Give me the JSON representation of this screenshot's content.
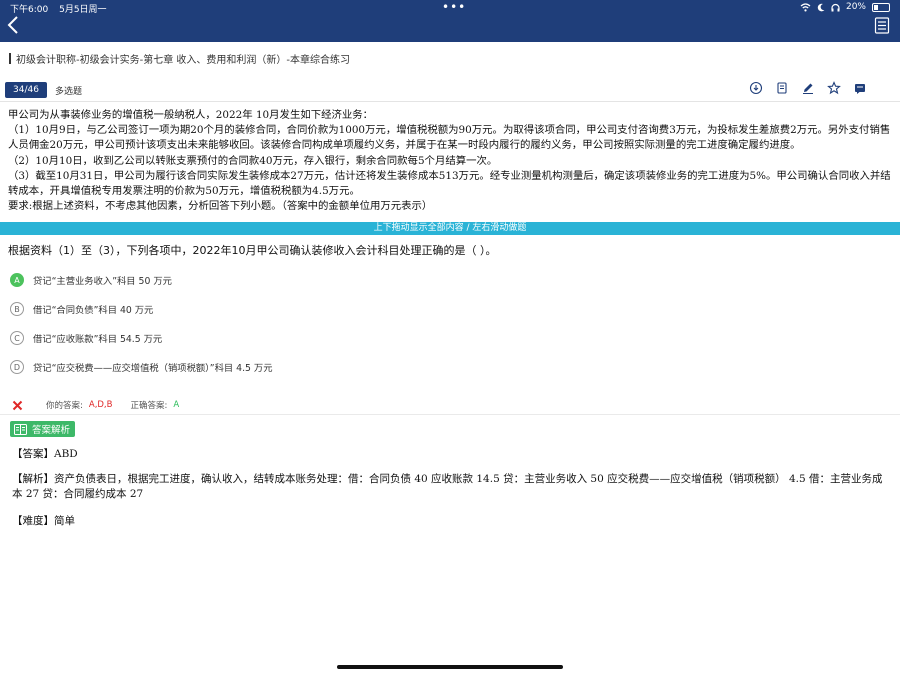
{
  "status": {
    "time": "下午6:00",
    "date": "5月5日周一",
    "dots": "•••",
    "battery": "20%"
  },
  "topbar": {
    "back_icon": "chevron-left-icon",
    "menu_icon": "answer-sheet-icon"
  },
  "breadcrumb": "初级会计职称-初级会计实务-第七章 收入、费用和利润（新）-本章综合练习",
  "question_header": {
    "number": "34/46",
    "type": "多选题",
    "tools": [
      "download-icon",
      "copy-icon",
      "edit-icon",
      "star-icon",
      "note-icon"
    ]
  },
  "stem": [
    "甲公司为从事装修业务的增值税一般纳税人，2022年 10月发生如下经济业务：",
    "（1）10月9日，与乙公司签订一项为期20个月的装修合同，合同价款为1000万元，增值税税额为90万元。为取得该项合同，甲公司支付咨询费3万元，为投标发生差旅费2万元。另外支付销售人员佣金20万元，甲公司预计该项支出未来能够收回。该装修合同构成单项履约义务，并属于在某一时段内履行的履约义务，甲公司按照实际测量的完工进度确定履约进度。",
    "（2）10月10日，收到乙公司以转账支票预付的合同款40万元，存入银行，剩余合同款每5个月结算一次。",
    "（3）截至10月31日，甲公司为履行该合同实际发生装修成本27万元，估计还将发生装修成本513万元。经专业测量机构测量后，确定该项装修业务的完工进度为5%。甲公司确认合同收入并结转成本，开具增值税专用发票注明的价款为50万元，增值税税额为4.5万元。",
    "要求:根据上述资料，不考虑其他因素，分析回答下列小题。（答案中的金额单位用万元表示）"
  ],
  "divider_text": "上下拖动显示全部内容 / 左右滑动做题",
  "question": "根据资料（1）至（3），下列各项中，2022年10月甲公司确认装修收入会计科目处理正确的是（ ）。",
  "options": [
    {
      "letter": "A",
      "text": "贷记“主营业务收入”科目 50 万元",
      "selected": true
    },
    {
      "letter": "B",
      "text": "借记“合同负债”科目 40 万元",
      "selected": false
    },
    {
      "letter": "C",
      "text": "借记“应收账款”科目 54.5 万元",
      "selected": false
    },
    {
      "letter": "D",
      "text": "贷记“应交税费——应交增值税（销项税额）”科目 4.5 万元",
      "selected": false
    }
  ],
  "result": {
    "status_icon": "wrong-x-icon",
    "your_answer_label": "你的答案:",
    "your_answer": "A,D,B",
    "correct_answer_label": "正确答案:",
    "correct_answer": "A"
  },
  "analysis": {
    "badge_label": "答案解析",
    "answer": "【答案】ABD",
    "explanation": "【解析】资产负债表日，根据完工进度，确认收入，结转成本账务处理：借：合同负债 40 应收账款 14.5 贷：主营业务收入 50 应交税费——应交增值税（销项税额） 4.5 借：主营业务成本 27 贷：合同履约成本 27",
    "difficulty": "【难度】简单"
  },
  "colors": {
    "nav_blue": "#1f3e7a",
    "divider_cyan": "#2ab3d6",
    "selected_green": "#4cc25d",
    "wrong_red": "#e02727",
    "correct_green": "#2bbd5a"
  }
}
